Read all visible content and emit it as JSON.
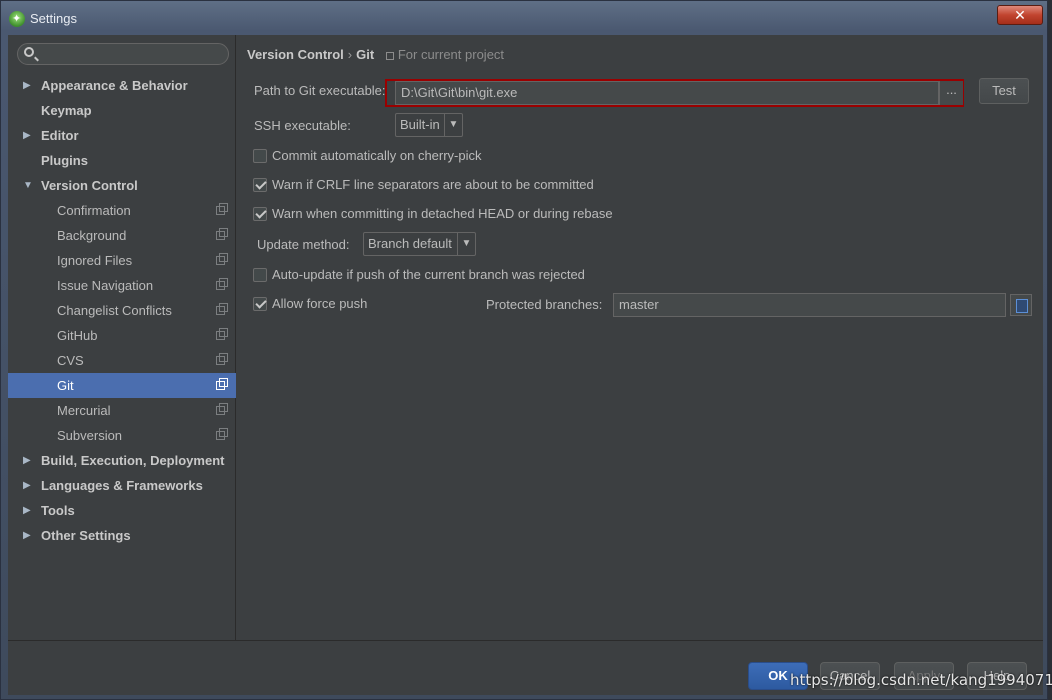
{
  "window": {
    "title": "Settings",
    "close_glyph": "✕"
  },
  "search": {
    "placeholder": ""
  },
  "sidebar": {
    "items": [
      {
        "label": "Appearance & Behavior",
        "level": "top",
        "arrow": "▶"
      },
      {
        "label": "Keymap",
        "level": "top",
        "arrow": ""
      },
      {
        "label": "Editor",
        "level": "top",
        "arrow": "▶"
      },
      {
        "label": "Plugins",
        "level": "top",
        "arrow": ""
      },
      {
        "label": "Version Control",
        "level": "top",
        "arrow": "▼"
      },
      {
        "label": "Confirmation",
        "level": "child"
      },
      {
        "label": "Background",
        "level": "child"
      },
      {
        "label": "Ignored Files",
        "level": "child"
      },
      {
        "label": "Issue Navigation",
        "level": "child"
      },
      {
        "label": "Changelist Conflicts",
        "level": "child"
      },
      {
        "label": "GitHub",
        "level": "child"
      },
      {
        "label": "CVS",
        "level": "child"
      },
      {
        "label": "Git",
        "level": "child",
        "selected": true
      },
      {
        "label": "Mercurial",
        "level": "child"
      },
      {
        "label": "Subversion",
        "level": "child"
      },
      {
        "label": "Build, Execution, Deployment",
        "level": "top",
        "arrow": "▶"
      },
      {
        "label": "Languages & Frameworks",
        "level": "top",
        "arrow": "▶"
      },
      {
        "label": "Tools",
        "level": "top",
        "arrow": "▶"
      },
      {
        "label": "Other Settings",
        "level": "top",
        "arrow": "▶"
      }
    ]
  },
  "breadcrumb": {
    "section": "Version Control",
    "separator": "›",
    "page": "Git",
    "scope": "For current project"
  },
  "git": {
    "path_label": "Path to Git executable:",
    "path_value": "D:\\Git\\Git\\bin\\git.exe",
    "browse_glyph": "...",
    "test_label": "Test",
    "ssh_label": "SSH executable:",
    "ssh_value": "Built-in",
    "commit_cherry_pick": {
      "label": "Commit automatically on cherry-pick",
      "checked": false
    },
    "warn_crlf": {
      "label": "Warn if CRLF line separators are about to be committed",
      "checked": true
    },
    "warn_detached": {
      "label": "Warn when committing in detached HEAD or during rebase",
      "checked": true
    },
    "update_method_label": "Update method:",
    "update_method_value": "Branch default",
    "auto_update": {
      "label": "Auto-update if push of the current branch was rejected",
      "checked": false
    },
    "allow_force_push": {
      "label": "Allow force push",
      "checked": true
    },
    "protected_branches_label": "Protected branches:",
    "protected_branches_value": "master",
    "dropdown_glyph": "▼"
  },
  "buttons": {
    "ok": "OK",
    "cancel": "Cancel",
    "apply": "Apply",
    "help": "Help"
  },
  "watermark": "https://blog.csdn.net/kang19940713"
}
